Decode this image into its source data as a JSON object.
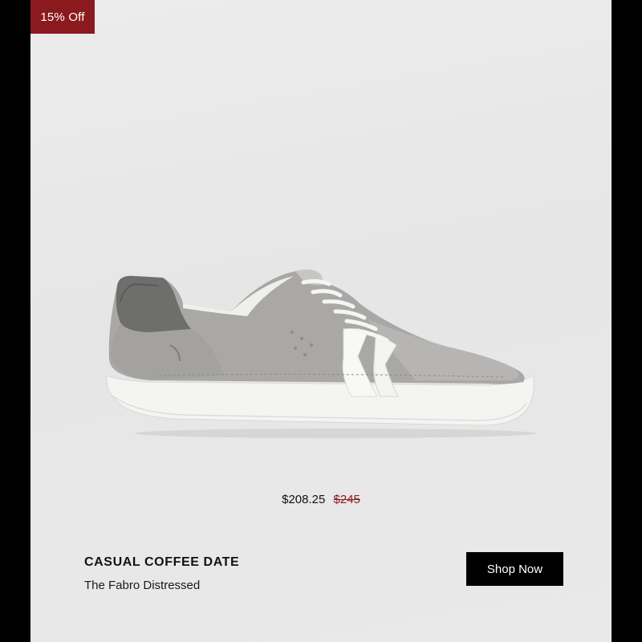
{
  "badge": {
    "label": "15% Off"
  },
  "product": {
    "image_icon": "sneaker-product-image",
    "price_current": "$208.25",
    "price_original": "$245",
    "title": "CASUAL COFFEE DATE",
    "subtitle": "The Fabro Distressed"
  },
  "cta": {
    "label": "Shop Now"
  },
  "colors": {
    "badge_bg": "#8b1a1f",
    "strike_price": "#8b1a1f",
    "button_bg": "#000000",
    "background": "#e9e9e9"
  }
}
